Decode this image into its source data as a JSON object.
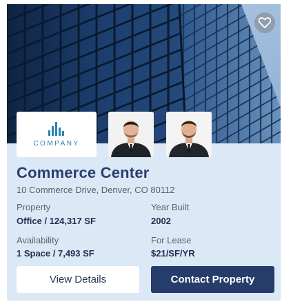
{
  "listing": {
    "title": "Commerce Center",
    "address": "10 Commerce Drive, Denver, CO 80112",
    "logo_text": "COMPANY",
    "details": {
      "property_label": "Property",
      "property_value": "Office / 124,317 SF",
      "year_label": "Year Built",
      "year_value": "2002",
      "availability_label": "Availability",
      "availability_value": "1 Space / 7,493 SF",
      "lease_label": "For Lease",
      "lease_value": "$21/SF/YR"
    },
    "buttons": {
      "view_details": "View Details",
      "contact_property": "Contact Property"
    }
  },
  "icons": {
    "favorite": "heart-icon",
    "logo": "bar-chart-logo"
  },
  "colors": {
    "card_background": "#dbe8f6",
    "title": "#2b3e6c",
    "primary_button": "#263c6b",
    "logo_accent": "#2d7fb2"
  }
}
